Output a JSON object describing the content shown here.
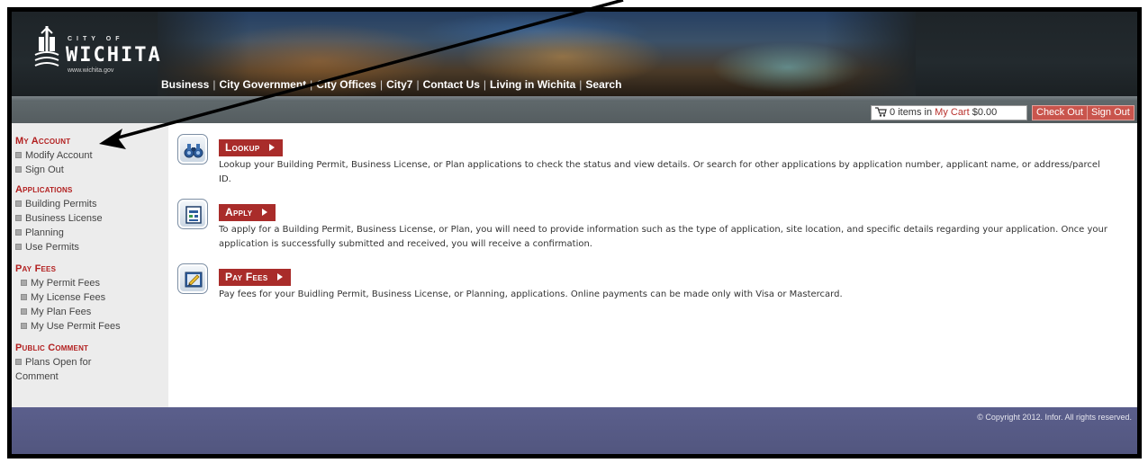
{
  "header": {
    "logo": {
      "city": "CITY OF",
      "name": "WICHITA",
      "url": "www.wichita.gov"
    },
    "nav": [
      "Business",
      "City Government",
      "City Offices",
      "City7",
      "Contact Us",
      "Living in Wichita",
      "Search"
    ]
  },
  "utility": {
    "cart_count": "0",
    "cart_text": "items in",
    "cart_link": "My Cart",
    "cart_total": "$0.00",
    "checkout": "Check Out",
    "signout": "Sign Out"
  },
  "sidebar": {
    "my_account": {
      "heading": "My Account",
      "items": [
        "Modify Account",
        "Sign Out"
      ]
    },
    "applications": {
      "heading": "Applications",
      "items": [
        "Building Permits",
        "Business License",
        "Planning",
        "Use Permits"
      ]
    },
    "pay_fees": {
      "heading": "Pay Fees",
      "items": [
        "My Permit Fees",
        "My License Fees",
        "My Plan Fees",
        "My Use Permit Fees"
      ]
    },
    "public_comment": {
      "heading": "Public Comment",
      "items": [
        "Plans Open for",
        "Comment"
      ]
    }
  },
  "sections": {
    "lookup": {
      "title": "Lookup",
      "line1": "Lookup your Building Permit, Business License, or Plan applications to check the status and view details. Or search for other applications by application number, applicant name, or address/parcel",
      "line2": "ID."
    },
    "apply": {
      "title": "Apply",
      "line1": "To apply for a Building Permit, Business License, or Plan, you will need to provide information such as the type of application, site location, and specific details regarding your application. Once your",
      "line2": "application is successfully submitted and received, you will receive a confirmation."
    },
    "pay_fees": {
      "title": "Pay Fees",
      "line1": "Pay fees for your Buidling Permit, Business License, or Planning, applications. Online payments can be made only with Visa or Mastercard."
    }
  },
  "footer": {
    "copyright": "© Copyright 2012. Infor. All rights reserved."
  },
  "colors": {
    "accent_red": "#a92c2a",
    "sidebar_heading": "#b21f1f",
    "footer": "#5b5f8c",
    "utility_bar": "#5f686b"
  }
}
